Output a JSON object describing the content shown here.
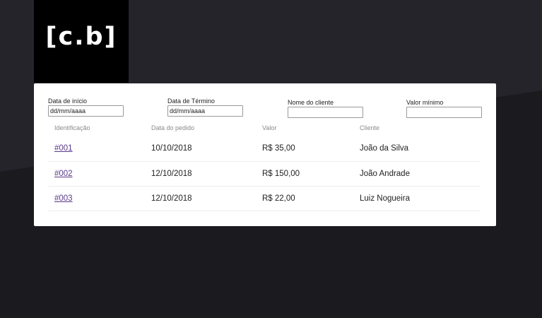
{
  "logo": {
    "text": "[c.b]"
  },
  "filters": {
    "start_date": {
      "label": "Data de início",
      "placeholder": "dd/mm/aaaa"
    },
    "end_date": {
      "label": "Data de Término",
      "placeholder": "dd/mm/aaaa"
    },
    "client_name": {
      "label": "Nome do cliente",
      "placeholder": ""
    },
    "min_value": {
      "label": "Valor mínimo",
      "placeholder": ""
    }
  },
  "table": {
    "headers": [
      "Identificação",
      "Data do pedido",
      "Valor",
      "Cliente"
    ],
    "rows": [
      {
        "id": "#001",
        "date": "10/10/2018",
        "value": "R$ 35,00",
        "client": "João da Silva"
      },
      {
        "id": "#002",
        "date": "12/10/2018",
        "value": "R$ 150,00",
        "client": "João Andrade"
      },
      {
        "id": "#003",
        "date": "12/10/2018",
        "value": "R$ 22,00",
        "client": "Luiz Nogueira"
      }
    ]
  },
  "colors": {
    "page_background": "#1b1a1f",
    "page_background_band": "#25242a",
    "link": "#5a3a8c"
  }
}
